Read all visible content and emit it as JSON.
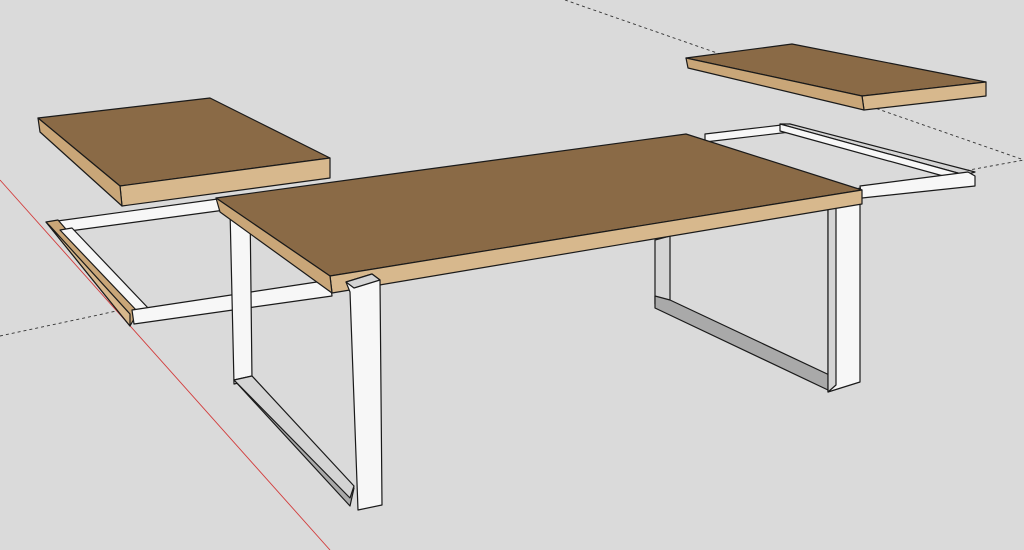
{
  "viewport": {
    "background": "#dadada",
    "mode": "3d-model-view"
  },
  "colors": {
    "wood_top": "#8a6a46",
    "wood_top_dark": "#7b5d3c",
    "wood_edge": "#d7b88d",
    "wood_edge_dark": "#c9a678",
    "frame_light": "#f7f7f7",
    "frame_shade": "#d4d4d4",
    "frame_dark": "#a9a9a9",
    "axis_red": "#d23c3c",
    "axis_dotted": "#333333",
    "outline": "#1a1a1a"
  },
  "model": {
    "components": [
      "main-tabletop",
      "left-extension-leaf",
      "right-extension-leaf",
      "left-slide-rail-frame",
      "right-slide-rail-frame",
      "front-left-leg",
      "back-right-leg"
    ]
  }
}
